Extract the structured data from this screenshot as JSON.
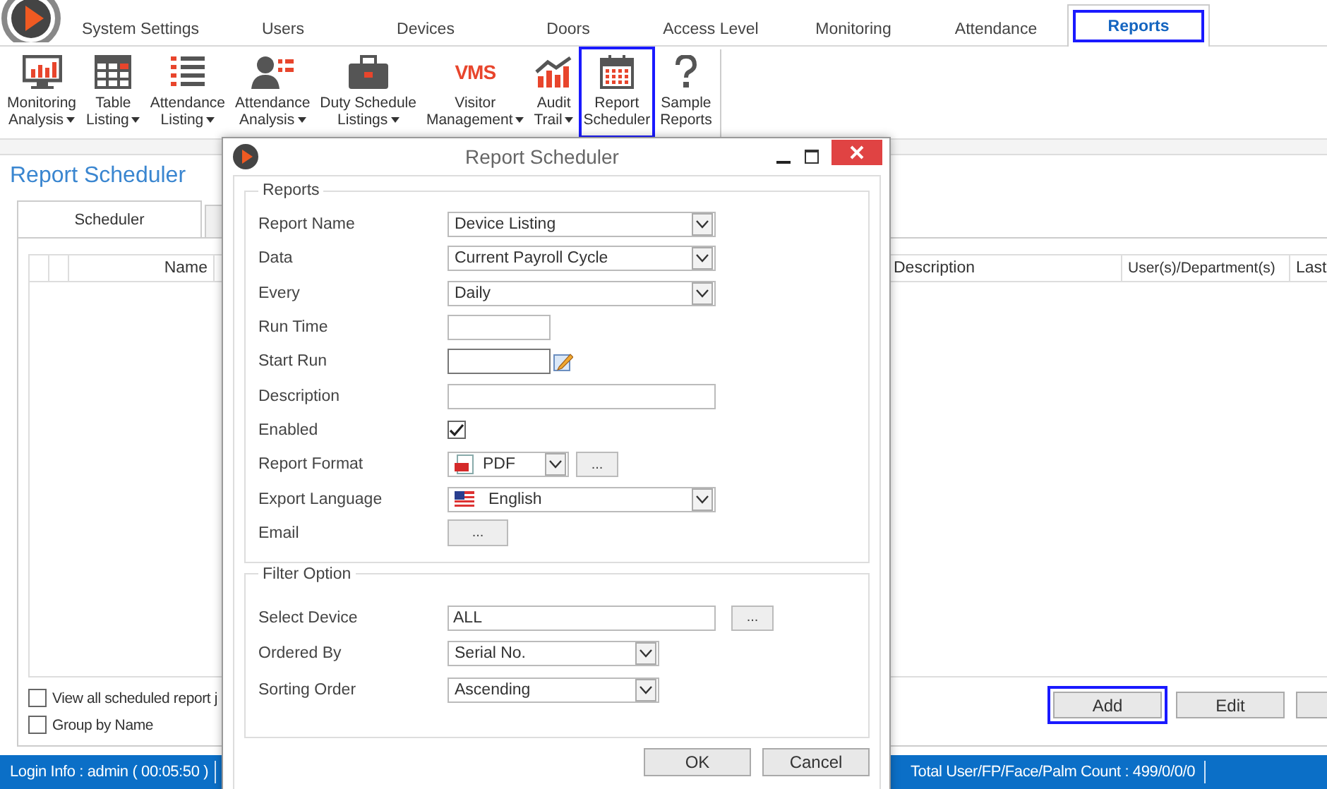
{
  "top_tabs": [
    {
      "label": "System Settings",
      "selected": false
    },
    {
      "label": "Users",
      "selected": false
    },
    {
      "label": "Devices",
      "selected": false
    },
    {
      "label": "Doors",
      "selected": false
    },
    {
      "label": "Access Level",
      "selected": false
    },
    {
      "label": "Monitoring",
      "selected": false
    },
    {
      "label": "Attendance",
      "selected": false
    },
    {
      "label": "Reports",
      "selected": true
    }
  ],
  "ribbon": [
    {
      "kind": "monitor",
      "lines": [
        "Monitoring",
        "Analysis"
      ],
      "dropdown": true,
      "selected": false
    },
    {
      "kind": "table",
      "lines": [
        "Table",
        "Listing"
      ],
      "dropdown": true,
      "selected": false
    },
    {
      "kind": "list",
      "lines": [
        "Attendance",
        "Listing"
      ],
      "dropdown": true,
      "selected": false
    },
    {
      "kind": "person",
      "lines": [
        "Attendance",
        "Analysis"
      ],
      "dropdown": true,
      "selected": false
    },
    {
      "kind": "briefcase",
      "lines": [
        "Duty Schedule",
        "Listings"
      ],
      "dropdown": true,
      "selected": false
    },
    {
      "kind": "vms",
      "icon_text": "VMS",
      "lines": [
        "Visitor",
        "Management"
      ],
      "dropdown": true,
      "selected": false
    },
    {
      "kind": "chart",
      "lines": [
        "Audit",
        "Trail"
      ],
      "dropdown": true,
      "selected": false
    },
    {
      "kind": "calendar",
      "lines": [
        "Report",
        "Scheduler"
      ],
      "dropdown": false,
      "selected": true
    },
    {
      "kind": "question",
      "lines": [
        "Sample",
        "Reports"
      ],
      "dropdown": false,
      "selected": false
    }
  ],
  "page": {
    "title": "Report Scheduler",
    "tabs": [
      {
        "label": "Scheduler",
        "selected": true
      }
    ],
    "columns": [
      "Name",
      "Description",
      "User(s)/Department(s)",
      "Last"
    ],
    "options": [
      {
        "label": "View all scheduled report j",
        "checked": false
      },
      {
        "label": "Group by Name",
        "checked": false
      }
    ],
    "buttons": [
      {
        "label": "Add",
        "focused": true
      },
      {
        "label": "Edit",
        "focused": false
      }
    ]
  },
  "dialog": {
    "title": "Report Scheduler",
    "groups": [
      {
        "title": "Reports",
        "fields": [
          {
            "kind": "combo",
            "label": "Report Name",
            "value": "Device Listing"
          },
          {
            "kind": "combo",
            "label": "Data",
            "value": "Current Payroll Cycle"
          },
          {
            "kind": "combo",
            "label": "Every",
            "value": "Daily"
          },
          {
            "kind": "time",
            "label": "Run Time"
          },
          {
            "kind": "date",
            "label": "Start Run"
          },
          {
            "kind": "text",
            "label": "Description"
          },
          {
            "kind": "checkbox",
            "label": "Enabled",
            "checked": true
          },
          {
            "kind": "format",
            "label": "Report Format",
            "value": "PDF",
            "button": "..."
          },
          {
            "kind": "language",
            "label": "Export Language",
            "value": "English"
          },
          {
            "kind": "email",
            "label": "Email",
            "button": "..."
          }
        ]
      },
      {
        "title": "Filter Option",
        "fields": [
          {
            "kind": "picker",
            "label": "Select Device",
            "value": "ALL",
            "button": "..."
          },
          {
            "kind": "combo-short",
            "label": "Ordered By",
            "value": "Serial No."
          },
          {
            "kind": "combo-short",
            "label": "Sorting Order",
            "value": "Ascending"
          }
        ]
      }
    ],
    "buttons": [
      "OK",
      "Cancel"
    ]
  },
  "status_bar": [
    "Login Info : admin ( 00:05:50 )",
    "Total User/FP/Face/Palm Count : 499/0/0/0"
  ]
}
